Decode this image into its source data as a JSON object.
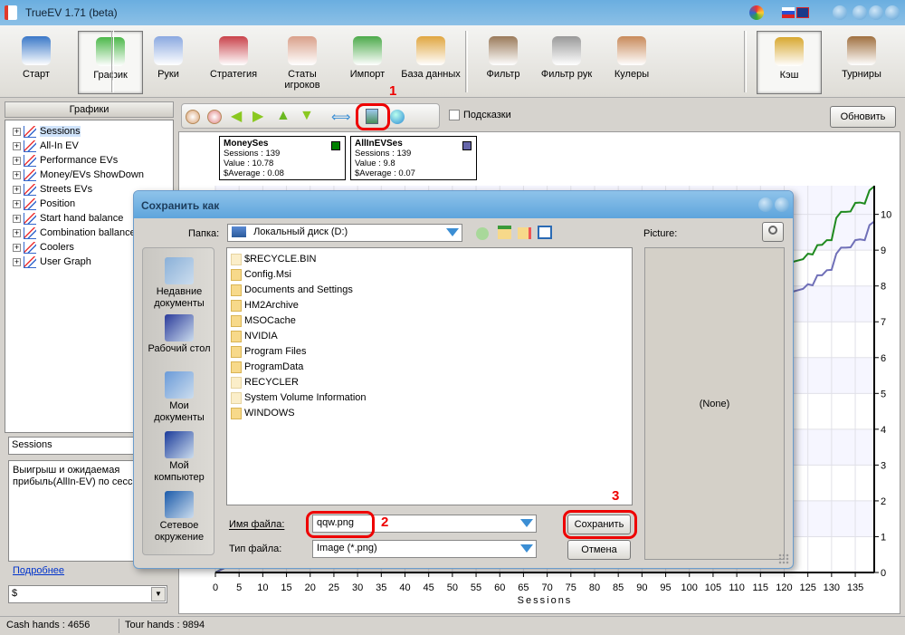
{
  "window": {
    "title": "TrueEV 1.71 (beta)"
  },
  "toolbar": {
    "items": [
      {
        "label": "Старт",
        "icon": "start-icon",
        "color": "#3a78c8"
      },
      {
        "label": "График",
        "icon": "chart-icon",
        "color": "#4cb84a",
        "active": true
      },
      {
        "label": "Руки",
        "icon": "hands-icon",
        "color": "#8aa8e0"
      },
      {
        "label": "Стратегия",
        "icon": "strategy-icon",
        "color": "#c9424a"
      },
      {
        "label": "Статы игроков",
        "icon": "players-icon",
        "color": "#d9a08a"
      },
      {
        "label": "Импорт",
        "icon": "import-icon",
        "color": "#4caa4a"
      },
      {
        "label": "База данных",
        "icon": "database-icon",
        "color": "#e0a640"
      },
      {
        "label": "Фильтр",
        "icon": "filter-icon",
        "color": "#9a7a5a"
      },
      {
        "label": "Фильтр рук",
        "icon": "hand-filter-icon",
        "color": "#999"
      },
      {
        "label": "Кулеры",
        "icon": "coolers-icon",
        "color": "#c88a5a"
      },
      {
        "label": "Кэш",
        "icon": "cash-icon",
        "color": "#d8a830",
        "active": true
      },
      {
        "label": "Турниры",
        "icon": "tournament-icon",
        "color": "#a07040"
      }
    ]
  },
  "left": {
    "header": "Графики",
    "tree": [
      "Sessions",
      "All-In EV",
      "Performance EVs",
      "Money/EVs ShowDown",
      "Streets EVs",
      "Position",
      "Start hand balance",
      "Combination ballance",
      "Coolers",
      "User Graph"
    ],
    "selected": "Sessions",
    "name_field": "Sessions",
    "description": "Выигрыш и ожидаемая прибыль(AllIn-EV) по сессиям",
    "more_link": "Подробнее",
    "currency": "$"
  },
  "chart_toolbar": {
    "hints_label": "Подсказки",
    "refresh_label": "Обновить",
    "annotation1": "1"
  },
  "legends": [
    {
      "title": "MoneySes",
      "sessions": "Sessions :   139",
      "value": "Value :  10.78",
      "average": "$Average : 0.08",
      "color": "#008000"
    },
    {
      "title": "AllInEVSes",
      "sessions": "Sessions :   139",
      "value": "Value :  9.8",
      "average": "$Average : 0.07",
      "color": "#6666aa"
    }
  ],
  "chart_data": {
    "type": "line",
    "xlabel": "Sessions",
    "xlim": [
      0,
      139
    ],
    "ylim": [
      0,
      10.8
    ],
    "xticks": [
      0,
      5,
      10,
      15,
      20,
      25,
      30,
      35,
      40,
      45,
      50,
      55,
      60,
      65,
      70,
      75,
      80,
      85,
      90,
      95,
      100,
      105,
      110,
      115,
      120,
      125,
      130,
      135
    ],
    "yticks": [
      0,
      1,
      2,
      3,
      4,
      5,
      6,
      7,
      8,
      9,
      10
    ],
    "grid": true,
    "series": [
      {
        "name": "MoneySes",
        "color": "#1f8a1f",
        "x": [
          0,
          122,
          124,
          125,
          126,
          127,
          128,
          129,
          130,
          131,
          132,
          133,
          134,
          135,
          136,
          137,
          138,
          139
        ],
        "y": [
          0,
          8.68,
          8.75,
          8.9,
          8.88,
          9.14,
          9.15,
          9.28,
          9.28,
          9.9,
          10.07,
          10.07,
          10.08,
          10.32,
          10.33,
          10.3,
          10.67,
          10.78
        ]
      },
      {
        "name": "AllInEVSes",
        "color": "#7070b8",
        "x": [
          0,
          122,
          124,
          125,
          126,
          127,
          128,
          129,
          130,
          131,
          132,
          133,
          134,
          135,
          136,
          137,
          138,
          139
        ],
        "y": [
          0,
          7.85,
          7.92,
          8.05,
          8.02,
          8.3,
          8.3,
          8.44,
          8.45,
          8.9,
          9.07,
          9.07,
          9.08,
          9.28,
          9.3,
          9.28,
          9.7,
          9.8
        ]
      }
    ]
  },
  "dialog": {
    "title": "Сохранить как",
    "folder_label": "Папка:",
    "folder_value": "Локальный диск (D:)",
    "picture_label": "Picture:",
    "picture_none": "(None)",
    "places": [
      "Недавние документы",
      "Рабочий стол",
      "Мои документы",
      "Мой компьютер",
      "Сетевое окружение"
    ],
    "files": [
      "$RECYCLE.BIN",
      "Config.Msi",
      "Documents and Settings",
      "HM2Archive",
      "MSOCache",
      "NVIDIA",
      "Program Files",
      "ProgramData",
      "RECYCLER",
      "System Volume Information",
      "WINDOWS"
    ],
    "filename_label": "Имя файла:",
    "filename_value": "qqw.png",
    "filetype_label": "Тип файла:",
    "filetype_value": "Image (*.png)",
    "save_label": "Сохранить",
    "cancel_label": "Отмена",
    "annotation2": "2",
    "annotation3": "3"
  },
  "status": {
    "cash": "Cash hands : 4656",
    "tour": "Tour hands : 9894"
  }
}
